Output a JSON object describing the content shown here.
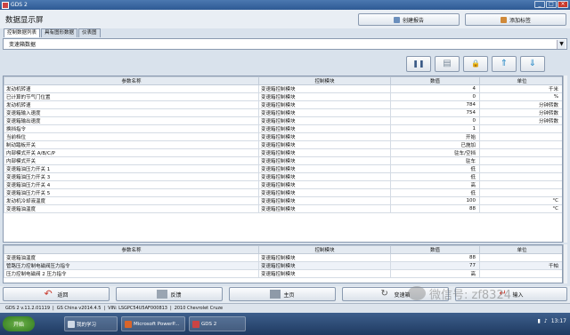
{
  "window": {
    "title": "GDS 2"
  },
  "header": {
    "page_title": "数据显示屏",
    "buttons": [
      {
        "label": "创建报告",
        "icon": "report-icon"
      },
      {
        "label": "添加标签",
        "icon": "tag-icon"
      }
    ]
  },
  "tabs": [
    {
      "label": "控制数据列表"
    },
    {
      "label": "具有图形数据"
    },
    {
      "label": "仪表图"
    }
  ],
  "dataset": {
    "selected": "变速箱数据"
  },
  "toolbar": [
    {
      "name": "pause-button",
      "glyph": "❚❚",
      "icon": "pause-icon"
    },
    {
      "name": "record-button",
      "glyph": "▤",
      "icon": "snapshot-icon"
    },
    {
      "name": "lock-button",
      "glyph": "🔒",
      "icon": "lock-icon"
    },
    {
      "name": "move-up-button",
      "glyph": "⇑",
      "icon": "arrow-up-icon"
    },
    {
      "name": "move-down-button",
      "glyph": "⇓",
      "icon": "arrow-down-icon"
    }
  ],
  "table": {
    "columns": [
      "参数名称",
      "控制模块",
      "数值",
      "单位"
    ],
    "rows": [
      [
        "发动机转速",
        "变速箱控制模块",
        "4",
        "千米"
      ],
      [
        "已计算的节气门位置",
        "变速箱控制模块",
        "0",
        "%"
      ],
      [
        "发动机转速",
        "变速箱控制模块",
        "784",
        "分钟转数"
      ],
      [
        "变速箱输入速度",
        "变速箱控制模块",
        "754",
        "分钟转数"
      ],
      [
        "变速箱输出速度",
        "变速箱控制模块",
        "0",
        "分钟转数"
      ],
      [
        "换挡指令",
        "变速箱控制模块",
        "1",
        ""
      ],
      [
        "当前档位",
        "变速箱控制模块",
        "开始",
        ""
      ],
      [
        "制动踏板开关",
        "变速箱控制模块",
        "已施加",
        ""
      ],
      [
        "内部模式开关 A/B/C/P",
        "变速箱控制模块",
        "驻车/空挡",
        ""
      ],
      [
        "内部模式开关",
        "变速箱控制模块",
        "驻车",
        ""
      ],
      [
        "变速箱油压力开关 1",
        "变速箱控制模块",
        "低",
        ""
      ],
      [
        "变速箱油压力开关 3",
        "变速箱控制模块",
        "低",
        ""
      ],
      [
        "变速箱油压力开关 4",
        "变速箱控制模块",
        "高",
        ""
      ],
      [
        "变速箱油压力开关 5",
        "变速箱控制模块",
        "低",
        ""
      ],
      [
        "发动机冷却液温度",
        "变速箱控制模块",
        "100",
        "°C"
      ],
      [
        "变速箱油温度",
        "变速箱控制模块",
        "88",
        "°C"
      ]
    ]
  },
  "selected_table": {
    "columns": [
      "参数名称",
      "控制模块",
      "数值",
      "单位"
    ],
    "rows": [
      [
        "变速箱油温度",
        "变速箱控制模块",
        "88",
        ""
      ],
      [
        "管路压力控制电磁阀压力指令",
        "变速箱控制模块",
        "77",
        "千帕"
      ],
      [
        "压力控制电磁阀 2 压力指令",
        "变速箱控制模块",
        "高",
        ""
      ]
    ]
  },
  "bottom_buttons": [
    {
      "label": "返回",
      "icon": "back-arrow-icon"
    },
    {
      "label": "反馈",
      "icon": "feedback-icon"
    },
    {
      "label": "主页",
      "icon": "home-icon"
    },
    {
      "label": "变速箱",
      "icon": "refresh-icon"
    },
    {
      "label": "输入",
      "icon": "enter-arrow-icon"
    }
  ],
  "status": {
    "version": "GDS 2 v.11.2.01119",
    "db": "GS China v2014.4.5",
    "vin": "VIN: LSGPC54U5AF000813",
    "vehicle": "2010 Chevrolet Cruze"
  },
  "taskbar": {
    "start": "开始",
    "tasks": [
      "我的学习",
      "Microsoft PowerP...",
      "GDS 2"
    ],
    "time": "13:17"
  },
  "watermark": {
    "text": "微信号: zf8324"
  },
  "colors": {
    "titlebar": "#2e5a94",
    "accent_red": "#c8392c",
    "taskbar": "#1f3a61"
  }
}
